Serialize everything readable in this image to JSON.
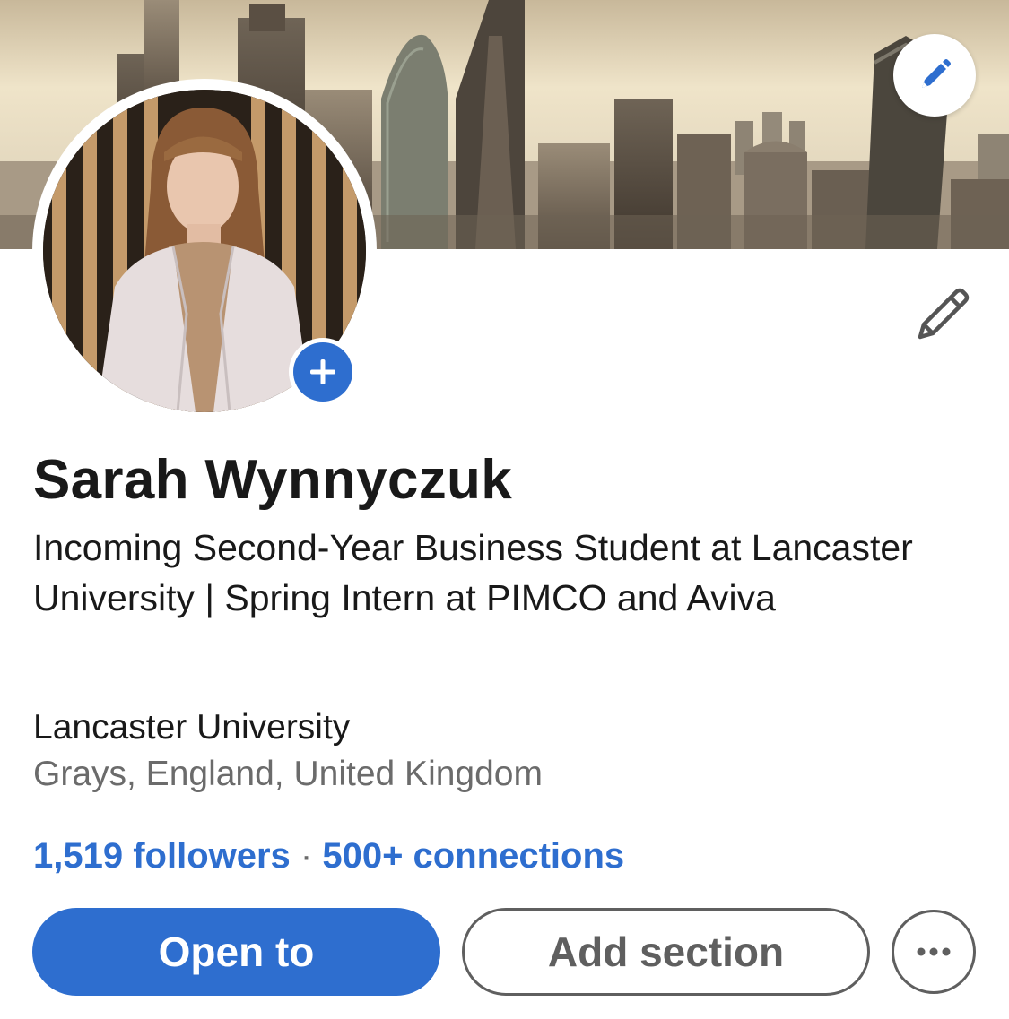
{
  "profile": {
    "name": "Sarah Wynnyczuk",
    "headline": "Incoming Second-Year Business Student at Lancaster University | Spring Intern at PIMCO and Aviva",
    "school": "Lancaster University",
    "location": "Grays, England, United Kingdom",
    "followers": "1,519 followers",
    "separator": " · ",
    "connections": "500+ connections"
  },
  "actions": {
    "open_to": "Open to",
    "add_section": "Add section"
  },
  "icons": {
    "cover_edit": "pencil-icon",
    "intro_edit": "pencil-outline-icon",
    "add_photo": "plus-icon",
    "more": "ellipsis-icon"
  },
  "colors": {
    "accent": "#2e6ecf",
    "text": "#191919",
    "muted": "#6b6b6b",
    "button_outline": "#5f5f5f"
  }
}
